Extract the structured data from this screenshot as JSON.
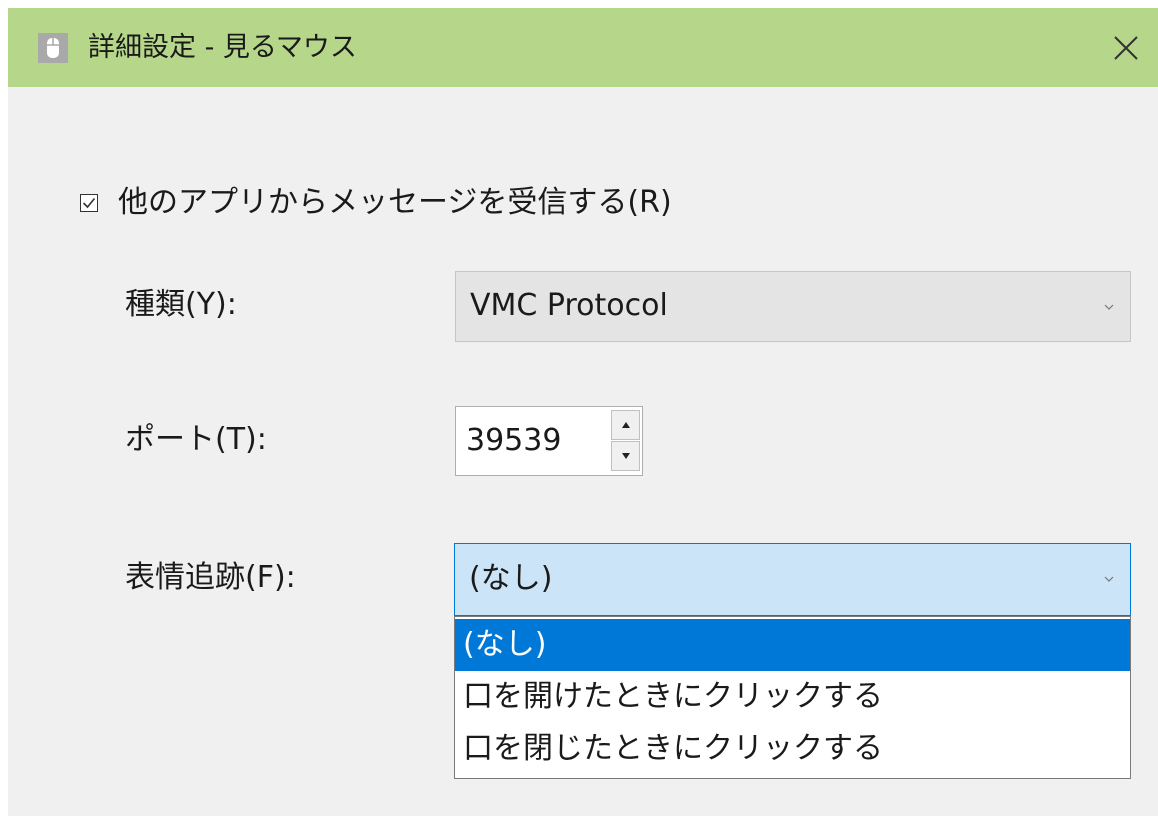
{
  "window": {
    "title": "詳細設定 - 見るマウス",
    "app_icon": "mouse-icon",
    "close_icon": "close-icon",
    "titlebar_color": "#b6d68a"
  },
  "receive_checkbox": {
    "label": "他のアプリからメッセージを受信する(R)",
    "checked": true
  },
  "type_field": {
    "label": "種類(Y):",
    "value": "VMC Protocol"
  },
  "port_field": {
    "label": "ポート(T):",
    "value": "39539"
  },
  "face_tracking": {
    "label": "表情追跡(F):",
    "value": "(なし)",
    "options": [
      "(なし)",
      "口を開けたときにクリックする",
      "口を閉じたときにクリックする"
    ],
    "selected_index": 0,
    "highlight_color": "#0078d7"
  }
}
